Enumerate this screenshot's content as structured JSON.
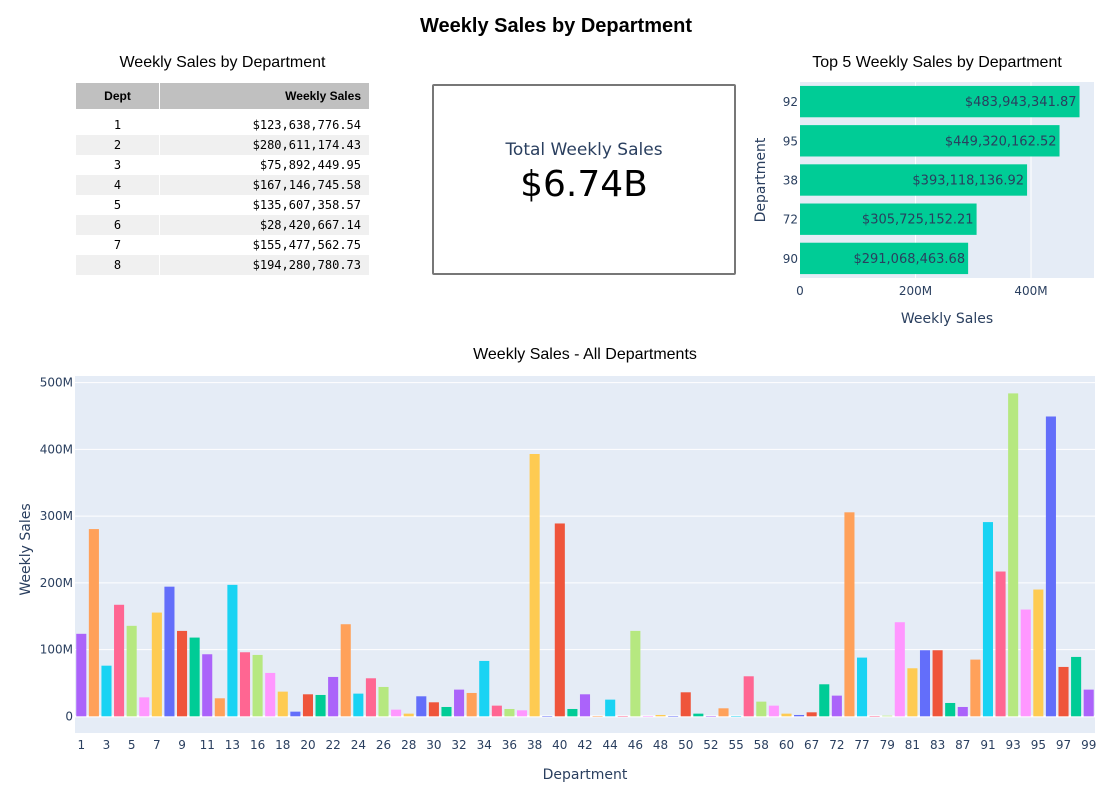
{
  "title": "Weekly Sales by Department",
  "table": {
    "title": "Weekly Sales by Department",
    "columns": [
      "Dept",
      "Weekly Sales"
    ],
    "rows": [
      [
        "1",
        "$123,638,776.54"
      ],
      [
        "2",
        "$280,611,174.43"
      ],
      [
        "3",
        "$75,892,449.95"
      ],
      [
        "4",
        "$167,146,745.58"
      ],
      [
        "5",
        "$135,607,358.57"
      ],
      [
        "6",
        "$28,420,667.14"
      ],
      [
        "7",
        "$155,477,562.75"
      ],
      [
        "8",
        "$194,280,780.73"
      ]
    ]
  },
  "kpi": {
    "label": "Total Weekly Sales",
    "value": "$6.74B"
  },
  "colors": {
    "plot_bg": "#e5ecf6",
    "top5_bar": "#00cc96",
    "palette": [
      "#ab63fa",
      "#ffa15a",
      "#19d3f3",
      "#ff6692",
      "#b6e880",
      "#ff97ff",
      "#fecb52",
      "#636efa",
      "#ef553b",
      "#00cc96"
    ]
  },
  "chart_data": [
    {
      "type": "bar",
      "orientation": "horizontal",
      "title": "Top 5 Weekly Sales by Department",
      "xlabel": "Weekly Sales",
      "ylabel": "Department",
      "categories": [
        "92",
        "95",
        "38",
        "72",
        "90"
      ],
      "values": [
        483943341.87,
        449320162.52,
        393118136.92,
        305725152.21,
        291068463.68
      ],
      "data_labels": [
        "$483,943,341.87",
        "$449,320,162.52",
        "$393,118,136.92",
        "$305,725,152.21",
        "$291,068,463.68"
      ],
      "xlim": [
        0,
        509000000
      ],
      "ticks": [
        0,
        200000000,
        400000000
      ],
      "tick_labels": [
        "0",
        "200M",
        "400M"
      ],
      "grid": true
    },
    {
      "type": "bar",
      "title": "Weekly Sales - All Departments",
      "xlabel": "Department",
      "ylabel": "Weekly Sales",
      "ylim": [
        -25000000,
        510000000
      ],
      "yticks": [
        0,
        100000000,
        200000000,
        300000000,
        400000000,
        500000000
      ],
      "ytick_labels": [
        "0",
        "100M",
        "200M",
        "300M",
        "400M",
        "500M"
      ],
      "xtick_labels": [
        "1",
        "3",
        "5",
        "7",
        "9",
        "11",
        "13",
        "16",
        "18",
        "20",
        "22",
        "24",
        "26",
        "28",
        "30",
        "32",
        "34",
        "36",
        "38",
        "40",
        "42",
        "44",
        "46",
        "48",
        "50",
        "52",
        "55",
        "58",
        "60",
        "67",
        "72",
        "77",
        "79",
        "81",
        "83",
        "87",
        "91",
        "93",
        "95",
        "97",
        "99"
      ],
      "grid": true,
      "categories": [
        "1",
        "2",
        "3",
        "4",
        "5",
        "6",
        "7",
        "8",
        "9",
        "10",
        "11",
        "12",
        "13",
        "14",
        "16",
        "17",
        "18",
        "19",
        "20",
        "21",
        "22",
        "23",
        "24",
        "25",
        "26",
        "27",
        "28",
        "29",
        "30",
        "31",
        "32",
        "33",
        "34",
        "35",
        "36",
        "37",
        "38",
        "39",
        "40",
        "41",
        "42",
        "43",
        "44",
        "45",
        "46",
        "47",
        "48",
        "49",
        "50",
        "51",
        "52",
        "54",
        "55",
        "56",
        "58",
        "59",
        "60",
        "65",
        "67",
        "71",
        "72",
        "74",
        "77",
        "78",
        "79",
        "80",
        "81",
        "82",
        "83",
        "85",
        "87",
        "90",
        "91",
        "92",
        "93",
        "94",
        "95",
        "96",
        "97",
        "98",
        "99"
      ],
      "values": [
        123638776.54,
        280611174.43,
        75892449.95,
        167146745.58,
        135607358.57,
        28420667.14,
        155477562.75,
        194280780.73,
        128000000,
        118000000,
        93000000,
        27000000,
        197000000,
        96000000,
        92000000,
        65000000,
        37000000,
        7000000,
        33000000,
        32000000,
        59000000,
        138000000,
        34000000,
        57000000,
        44000000,
        10000000,
        4000000,
        30000000,
        21000000,
        14000000,
        40000000,
        35000000,
        83000000,
        16000000,
        11000000,
        9000000,
        393118136.92,
        200000,
        289000000,
        11000000,
        33000000,
        0,
        25000000,
        0,
        128000000,
        0,
        2000000,
        0,
        36000000,
        4000000,
        0,
        12000000,
        0,
        60000000,
        22000000,
        16000000,
        4000000,
        2000000,
        6000000,
        48000000,
        31000000,
        305725152.21,
        88000000,
        0,
        1000000,
        141000000,
        72000000,
        99000000,
        99000000,
        20000000,
        14000000,
        85000000,
        291068463.68,
        217000000,
        483943341.87,
        160000000,
        190000000,
        449320162.52,
        74000000,
        89000000,
        40000000
      ]
    }
  ]
}
